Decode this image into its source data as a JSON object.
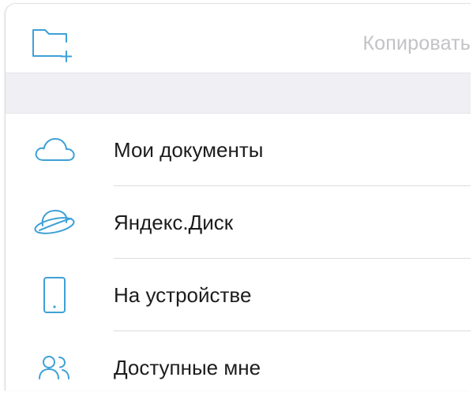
{
  "toolbar": {
    "new_folder_icon": "new-folder-icon",
    "copy_label": "Копировать",
    "copy_color": "#c2c2c7"
  },
  "accent_color": "#3ea0d6",
  "locations": [
    {
      "label": "Мои документы",
      "icon": "cloud-icon"
    },
    {
      "label": "Яндекс.Диск",
      "icon": "yandex-disk-icon"
    },
    {
      "label": "На устройстве",
      "icon": "tablet-icon"
    },
    {
      "label": "Доступные мне",
      "icon": "shared-users-icon"
    }
  ]
}
